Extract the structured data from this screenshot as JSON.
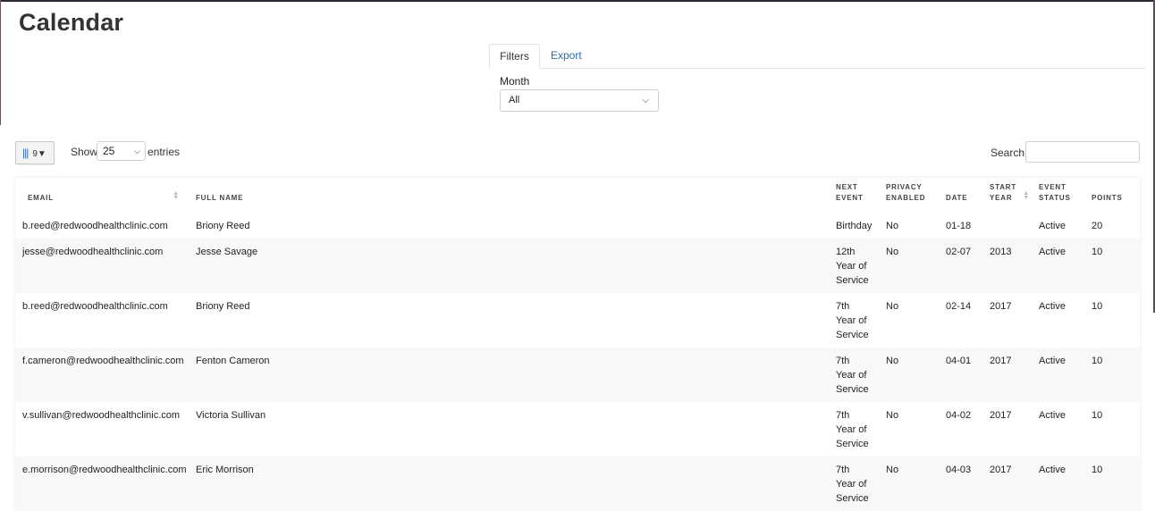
{
  "page": {
    "title": "Calendar"
  },
  "tabs": [
    {
      "label": "Filters",
      "active": true
    },
    {
      "label": "Export",
      "active": false
    }
  ],
  "filters": {
    "month_label": "Month",
    "month_value": "All"
  },
  "toolbar": {
    "column_count": "9",
    "show_label": "Show",
    "page_length": "25",
    "entries_label": "entries",
    "search_label": "Search:",
    "search_value": ""
  },
  "table": {
    "headers": {
      "email": "EMAIL",
      "full_name": "FULL NAME",
      "next_event": "NEXT EVENT",
      "privacy_enabled": "PRIVACY ENABLED",
      "date": "DATE",
      "start_year": "START YEAR",
      "event_status": "EVENT STATUS",
      "points": "POINTS"
    },
    "rows": [
      {
        "email": "b.reed@redwoodhealthclinic.com",
        "full_name": "Briony Reed",
        "next_event": "Birthday",
        "privacy": "No",
        "date": "01-18",
        "start_year": "",
        "status": "Active",
        "points": "20"
      },
      {
        "email": "jesse@redwoodhealthclinic.com",
        "full_name": "Jesse Savage",
        "next_event": "12th Year of Service",
        "privacy": "No",
        "date": "02-07",
        "start_year": "2013",
        "status": "Active",
        "points": "10"
      },
      {
        "email": "b.reed@redwoodhealthclinic.com",
        "full_name": "Briony Reed",
        "next_event": "7th Year of Service",
        "privacy": "No",
        "date": "02-14",
        "start_year": "2017",
        "status": "Active",
        "points": "10"
      },
      {
        "email": "f.cameron@redwoodhealthclinic.com",
        "full_name": "Fenton Cameron",
        "next_event": "7th Year of Service",
        "privacy": "No",
        "date": "04-01",
        "start_year": "2017",
        "status": "Active",
        "points": "10"
      },
      {
        "email": "v.sullivan@redwoodhealthclinic.com",
        "full_name": "Victoria Sullivan",
        "next_event": "7th Year of Service",
        "privacy": "No",
        "date": "04-02",
        "start_year": "2017",
        "status": "Active",
        "points": "10"
      },
      {
        "email": "e.morrison@redwoodhealthclinic.com",
        "full_name": "Eric Morrison",
        "next_event": "7th Year of Service",
        "privacy": "No",
        "date": "04-03",
        "start_year": "2017",
        "status": "Active",
        "points": "10"
      }
    ]
  }
}
